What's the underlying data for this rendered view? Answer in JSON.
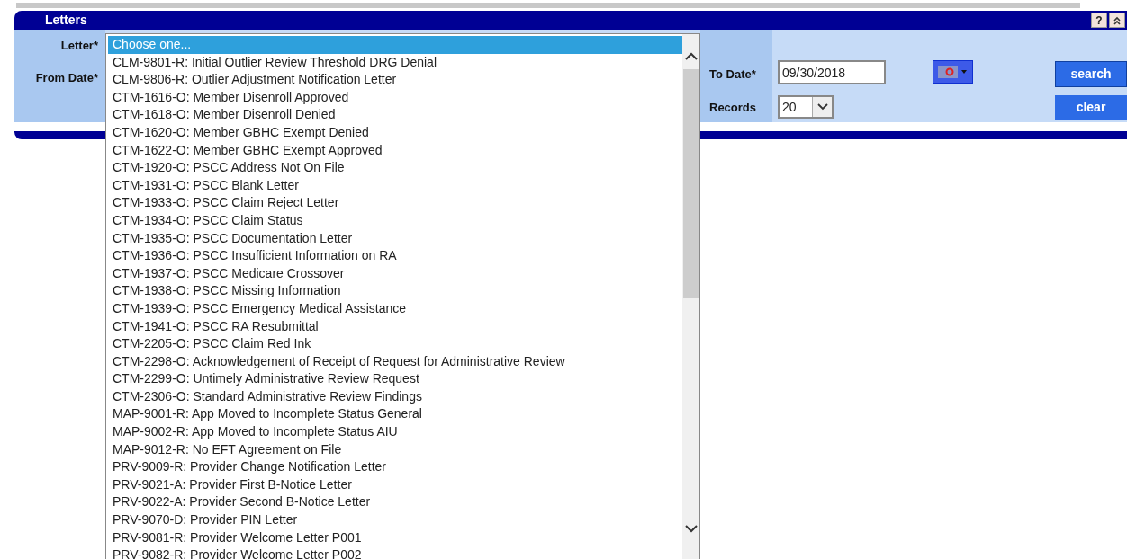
{
  "panel": {
    "title": "Letters",
    "help_button": "?"
  },
  "form": {
    "letter_label": "Letter*",
    "from_date_label": "From Date*",
    "to_date_label": "To Date*",
    "to_date_value": "09/30/2018",
    "records_label": "Records",
    "records_value": "20",
    "buttons": [
      "search",
      "clear"
    ]
  },
  "letter_options": [
    {
      "label": "Choose one...",
      "selected": true
    },
    {
      "label": "CLM-9801-R: Initial Outlier Review Threshold DRG Denial",
      "selected": false
    },
    {
      "label": "CLM-9806-R: Outlier Adjustment Notification Letter",
      "selected": false
    },
    {
      "label": "CTM-1616-O: Member Disenroll Approved",
      "selected": false
    },
    {
      "label": "CTM-1618-O: Member Disenroll Denied",
      "selected": false
    },
    {
      "label": "CTM-1620-O: Member GBHC Exempt Denied",
      "selected": false
    },
    {
      "label": "CTM-1622-O: Member GBHC Exempt Approved",
      "selected": false
    },
    {
      "label": "CTM-1920-O: PSCC Address Not On File",
      "selected": false
    },
    {
      "label": "CTM-1931-O: PSCC Blank Letter",
      "selected": false
    },
    {
      "label": "CTM-1933-O: PSCC Claim Reject Letter",
      "selected": false
    },
    {
      "label": "CTM-1934-O: PSCC Claim Status",
      "selected": false
    },
    {
      "label": "CTM-1935-O: PSCC Documentation Letter",
      "selected": false
    },
    {
      "label": "CTM-1936-O: PSCC Insufficient Information on RA",
      "selected": false
    },
    {
      "label": "CTM-1937-O: PSCC Medicare Crossover",
      "selected": false
    },
    {
      "label": "CTM-1938-O: PSCC Missing Information",
      "selected": false
    },
    {
      "label": "CTM-1939-O: PSCC Emergency Medical Assistance",
      "selected": false
    },
    {
      "label": "CTM-1941-O: PSCC RA Resubmittal",
      "selected": false
    },
    {
      "label": "CTM-2205-O: PSCC Claim Red Ink",
      "selected": false
    },
    {
      "label": "CTM-2298-O: Acknowledgement of Receipt of Request for Administrative Review",
      "selected": false
    },
    {
      "label": "CTM-2299-O: Untimely Administrative Review Request",
      "selected": false
    },
    {
      "label": "CTM-2306-O: Standard Administrative Review Findings",
      "selected": false
    },
    {
      "label": "MAP-9001-R: App Moved to Incomplete Status General",
      "selected": false
    },
    {
      "label": "MAP-9002-R: App Moved to Incomplete Status AIU",
      "selected": false
    },
    {
      "label": "MAP-9012-R: No EFT Agreement on File",
      "selected": false
    },
    {
      "label": "PRV-9009-R: Provider Change Notification Letter",
      "selected": false
    },
    {
      "label": "PRV-9021-A: Provider First B-Notice Letter",
      "selected": false
    },
    {
      "label": "PRV-9022-A: Provider Second B-Notice Letter",
      "selected": false
    },
    {
      "label": "PRV-9070-D: Provider PIN Letter",
      "selected": false
    },
    {
      "label": "PRV-9081-R: Provider Welcome Letter P001",
      "selected": false
    },
    {
      "label": "PRV-9082-R: Provider Welcome Letter P002",
      "selected": false
    }
  ]
}
